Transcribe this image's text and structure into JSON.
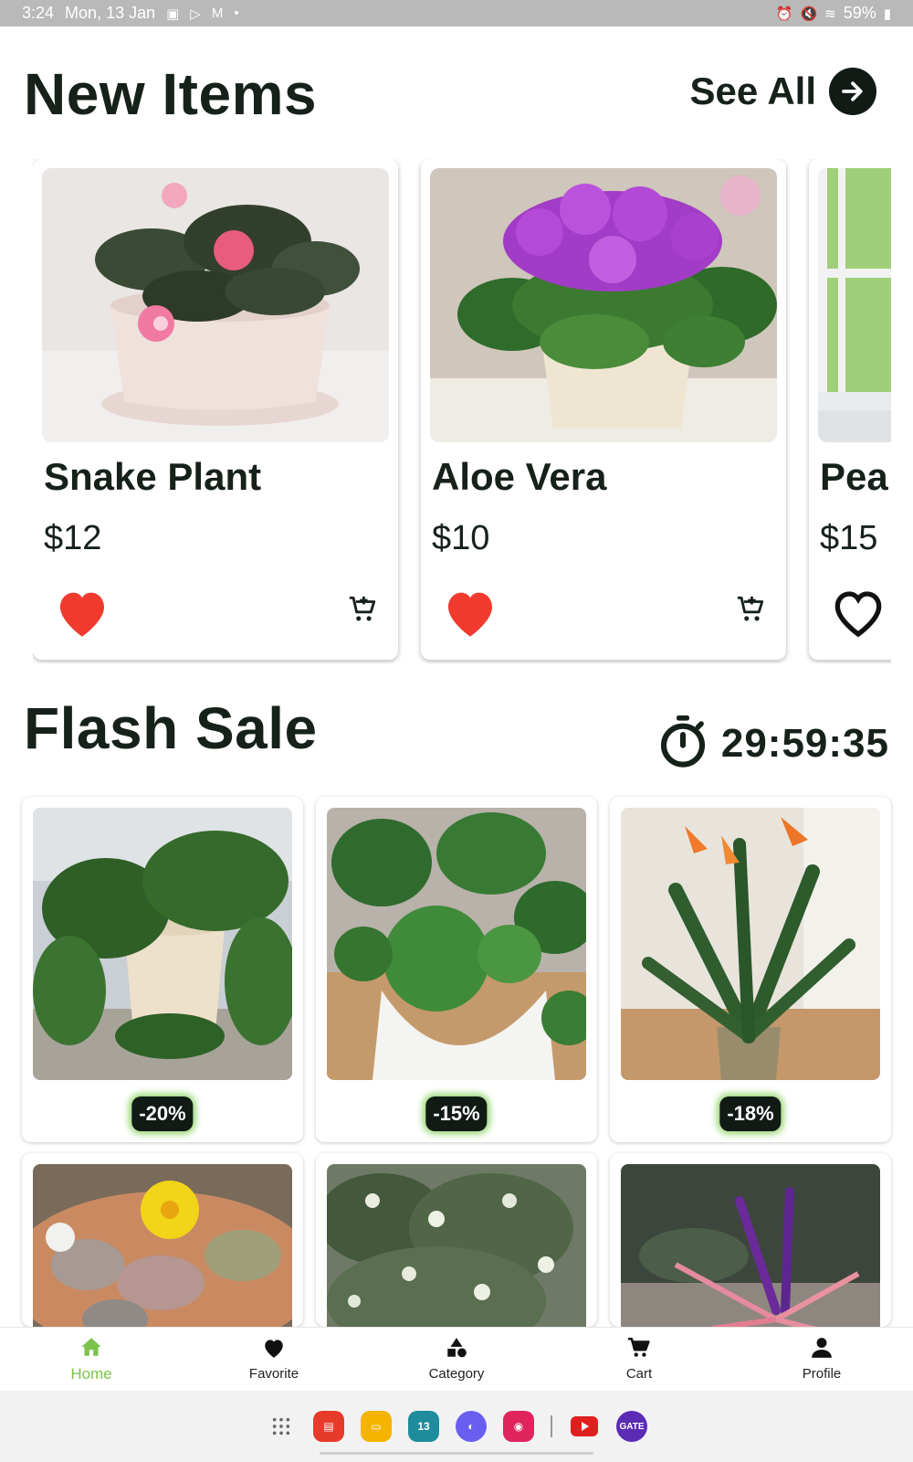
{
  "status_bar": {
    "time": "3:24",
    "date": "Mon, 13 Jan",
    "battery": "59%"
  },
  "new_items": {
    "title": "New Items",
    "see_all_label": "See All",
    "items": [
      {
        "name": "Snake Plant",
        "price": "$12",
        "favorited": true
      },
      {
        "name": "Aloe Vera",
        "price": "$10",
        "favorited": true
      },
      {
        "name": "Pea",
        "price": "$15",
        "favorited": false
      }
    ]
  },
  "flash_sale": {
    "title": "Flash Sale",
    "timer": "29:59:35",
    "items": [
      {
        "discount": "-20%"
      },
      {
        "discount": "-15%"
      },
      {
        "discount": "-18%"
      },
      {
        "discount": ""
      },
      {
        "discount": ""
      },
      {
        "discount": ""
      }
    ]
  },
  "bottom_nav": {
    "items": [
      {
        "label": "Home",
        "icon": "home-icon",
        "active": true
      },
      {
        "label": "Favorite",
        "icon": "heart-icon",
        "active": false
      },
      {
        "label": "Category",
        "icon": "category-icon",
        "active": false
      },
      {
        "label": "Cart",
        "icon": "cart-icon",
        "active": false
      },
      {
        "label": "Profile",
        "icon": "profile-icon",
        "active": false
      }
    ]
  },
  "taskbar": {
    "calendar_day": "13",
    "gate_label": "GATE"
  },
  "colors": {
    "accent": "#7cc24c",
    "heart": "#f03a2e",
    "dark": "#111a14"
  }
}
